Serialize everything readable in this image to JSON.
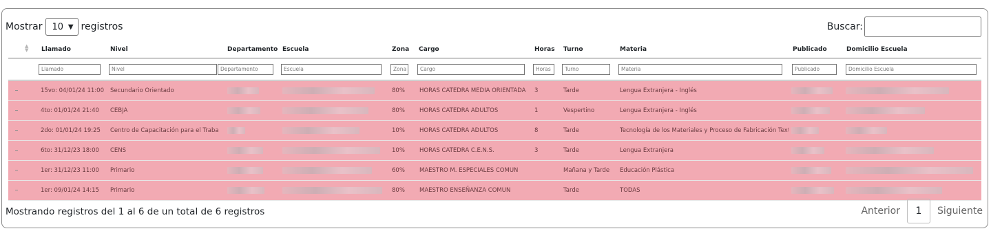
{
  "length": {
    "prefix": "Mostrar",
    "value": "10",
    "suffix": "registros"
  },
  "search": {
    "label": "Buscar:"
  },
  "columns": [
    "Llamado",
    "Nivel",
    "Departamento",
    "Escuela",
    "Zona",
    "Cargo",
    "Horas",
    "Turno",
    "Materia",
    "Publicado",
    "Domicilio Escuela"
  ],
  "filters": [
    "Llamado",
    "Nivel",
    "Departamento",
    "Escuela",
    "Zona",
    "Cargo",
    "Horas",
    "Turno",
    "Materia",
    "Publicado",
    "Domicilio Escuela"
  ],
  "rows": [
    {
      "llamado": "15vo: 04/01/24 11:00",
      "nivel": "Secundario Orientado",
      "zona": "80%",
      "cargo": "HORAS CATEDRA MEDIA ORIENTADA",
      "horas": "3",
      "turno": "Tarde",
      "materia": "Lengua Extranjera - Inglés"
    },
    {
      "llamado": "4to: 01/01/24 21:40",
      "nivel": "CEBJA",
      "zona": "80%",
      "cargo": "HORAS CATEDRA ADULTOS",
      "horas": "1",
      "turno": "Vespertino",
      "materia": "Lengua Extranjera - Inglés"
    },
    {
      "llamado": "2do: 01/01/24 19:25",
      "nivel": "Centro de Capacitación para el Trabaj",
      "zona": "10%",
      "cargo": "HORAS CATEDRA ADULTOS",
      "horas": "8",
      "turno": "Tarde",
      "materia": "Tecnología de los Materiales y Proceso de Fabricación Textil"
    },
    {
      "llamado": "6to: 31/12/23 18:00",
      "nivel": "CENS",
      "zona": "10%",
      "cargo": "HORAS CATEDRA C.E.N.S.",
      "horas": "3",
      "turno": "Tarde",
      "materia": "Lengua Extranjera"
    },
    {
      "llamado": "1er: 31/12/23 11:00",
      "nivel": "Primario",
      "zona": "60%",
      "cargo": "MAESTRO M. ESPECIALES COMUN",
      "horas": "",
      "turno": "Mañana y Tarde",
      "materia": "Educación Plástica"
    },
    {
      "llamado": "1er: 09/01/24 14:15",
      "nivel": "Primario",
      "zona": "80%",
      "cargo": "MAESTRO ENSEÑANZA COMUN",
      "horas": "",
      "turno": "Tarde",
      "materia": "TODAS"
    }
  ],
  "footer": {
    "info": "Mostrando registros del 1 al 6 de un total de 6 registros",
    "prev": "Anterior",
    "page": "1",
    "next": "Siguiente"
  },
  "colors": {
    "row_bg": "#f2aab3",
    "border": "#8a8a8a"
  }
}
